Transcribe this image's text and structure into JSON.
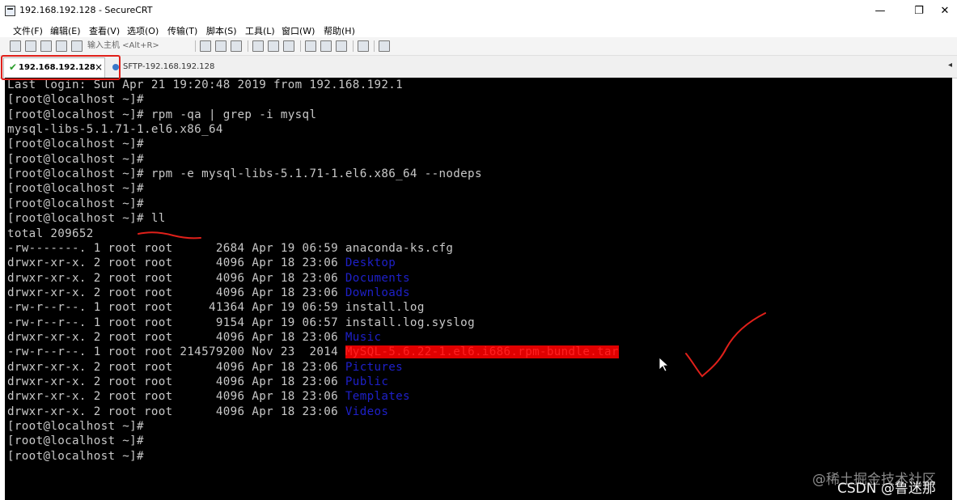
{
  "window": {
    "title": "192.168.192.128 - SecureCRT",
    "minimize_glyph": "—",
    "maximize_glyph": "❐",
    "close_glyph": "✕"
  },
  "menu": [
    "文件(F)",
    "编辑(E)",
    "查看(V)",
    "选项(O)",
    "传输(T)",
    "脚本(S)",
    "工具(L)",
    "窗口(W)",
    "帮助(H)"
  ],
  "toolbar": {
    "host_placeholder": "输入主机 <Alt+R>"
  },
  "tabs": {
    "active_label": "192.168.192.128",
    "close_glyph": "×",
    "check_glyph": "✔",
    "second_label": "SFTP-192.168.192.128",
    "scroll_glyph": "◂"
  },
  "terminal": {
    "lines": [
      "Last login: Sun Apr 21 19:20:48 2019 from 192.168.192.1",
      "[root@localhost ~]#",
      "[root@localhost ~]# rpm -qa | grep -i mysql",
      "mysql-libs-5.1.71-1.el6.x86_64",
      "[root@localhost ~]#",
      "[root@localhost ~]#",
      "[root@localhost ~]# rpm -e mysql-libs-5.1.71-1.el6.x86_64 --nodeps",
      "[root@localhost ~]#",
      "[root@localhost ~]#",
      "[root@localhost ~]# ll",
      "total 209652"
    ],
    "listing": [
      {
        "meta": "-rw-------. 1 root root      2684 Apr 19 06:59 ",
        "name": "anaconda-ks.cfg",
        "kind": "file"
      },
      {
        "meta": "drwxr-xr-x. 2 root root      4096 Apr 18 23:06 ",
        "name": "Desktop",
        "kind": "dir"
      },
      {
        "meta": "drwxr-xr-x. 2 root root      4096 Apr 18 23:06 ",
        "name": "Documents",
        "kind": "dir"
      },
      {
        "meta": "drwxr-xr-x. 2 root root      4096 Apr 18 23:06 ",
        "name": "Downloads",
        "kind": "dir"
      },
      {
        "meta": "-rw-r--r--. 1 root root     41364 Apr 19 06:59 ",
        "name": "install.log",
        "kind": "file"
      },
      {
        "meta": "-rw-r--r--. 1 root root      9154 Apr 19 06:57 ",
        "name": "install.log.syslog",
        "kind": "file"
      },
      {
        "meta": "drwxr-xr-x. 2 root root      4096 Apr 18 23:06 ",
        "name": "Music",
        "kind": "dir"
      },
      {
        "meta": "-rw-r--r--. 1 root root 214579200 Nov 23  2014 ",
        "name": "MySQL-5.6.22-1.el6.i686.rpm-bundle.tar",
        "kind": "highlight"
      },
      {
        "meta": "drwxr-xr-x. 2 root root      4096 Apr 18 23:06 ",
        "name": "Pictures",
        "kind": "dir"
      },
      {
        "meta": "drwxr-xr-x. 2 root root      4096 Apr 18 23:06 ",
        "name": "Public",
        "kind": "dir"
      },
      {
        "meta": "drwxr-xr-x. 2 root root      4096 Apr 18 23:06 ",
        "name": "Templates",
        "kind": "dir"
      },
      {
        "meta": "drwxr-xr-x. 2 root root      4096 Apr 18 23:06 ",
        "name": "Videos",
        "kind": "dir"
      }
    ],
    "trailing": [
      "[root@localhost ~]#",
      "[root@localhost ~]#",
      "[root@localhost ~]#"
    ]
  },
  "watermark": {
    "line1": "@稀土掘金技术社区",
    "line2": "CSDN @鲁迷那"
  },
  "colors": {
    "terminal_bg": "#000000",
    "terminal_fg": "#c8c8c8",
    "dir_fg": "#1e20c8",
    "annotation_red": "#e0201a"
  }
}
